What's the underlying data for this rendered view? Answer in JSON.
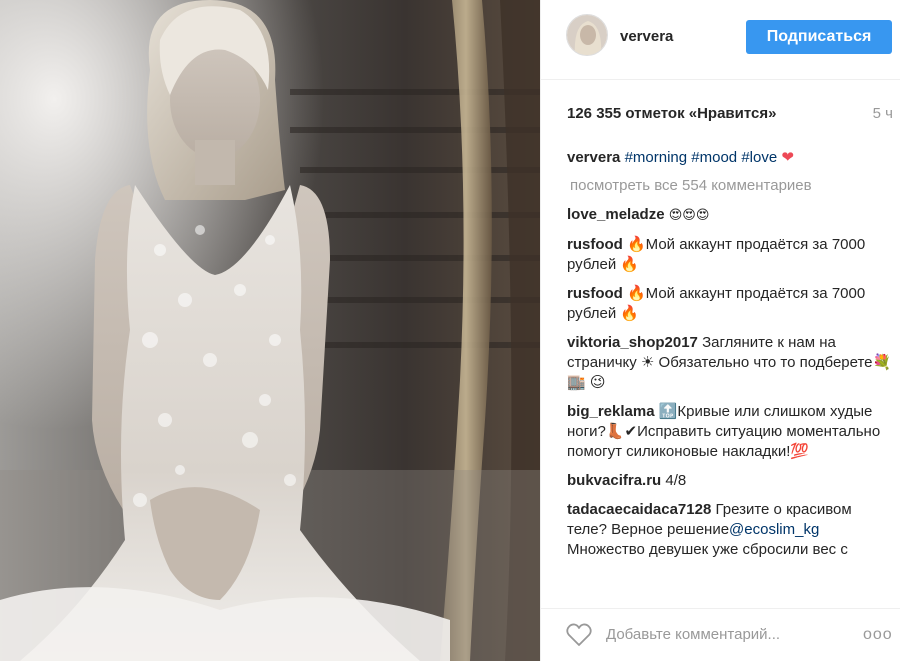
{
  "post": {
    "username": "ververa",
    "follow_label": "Подписаться",
    "likes": "126 355 отметок «Нравится»",
    "time": "5 ч",
    "caption": {
      "user": "ververa",
      "tags": [
        "#morning",
        "#mood",
        "#love"
      ],
      "heart": "❤"
    },
    "view_all": "посмотреть все 554 комментариев",
    "comments": [
      {
        "user": "love_meladze",
        "text": "😍😍😍"
      },
      {
        "user": "rusfood",
        "text": "🔥Мой аккаунт продаётся за 7000 рублей 🔥"
      },
      {
        "user": "rusfood",
        "text": "🔥Мой аккаунт продаётся за 7000 рублей 🔥"
      },
      {
        "user": "viktoria_shop2017",
        "text": "Загляните к нам на страничку ☀ Обязательно что то подберете💐🏬 😉"
      },
      {
        "user": "big_reklama",
        "text": "🔝Кривые или слишком худые ноги?👢✔Исправить ситуацию моментально помогут силиконовые накладки!💯"
      },
      {
        "user": "bukvacifra.ru",
        "text": "4/8"
      },
      {
        "user": "tadacaecaidaca7128",
        "text_before": "Грезите о красивом теле? Верное решение",
        "mention": "@ecoslim_kg",
        "text_after": " Множество девушек уже сбросили вес с"
      }
    ],
    "comment_placeholder": "Добавьте комментарий...",
    "more_label": "ooo"
  },
  "icons": {
    "like": "heart-outline-icon",
    "more": "ellipsis-icon"
  },
  "colors": {
    "follow_button": "#3897f0",
    "hashtag": "#003569",
    "heart": "#ed4956",
    "muted": "#999999"
  }
}
